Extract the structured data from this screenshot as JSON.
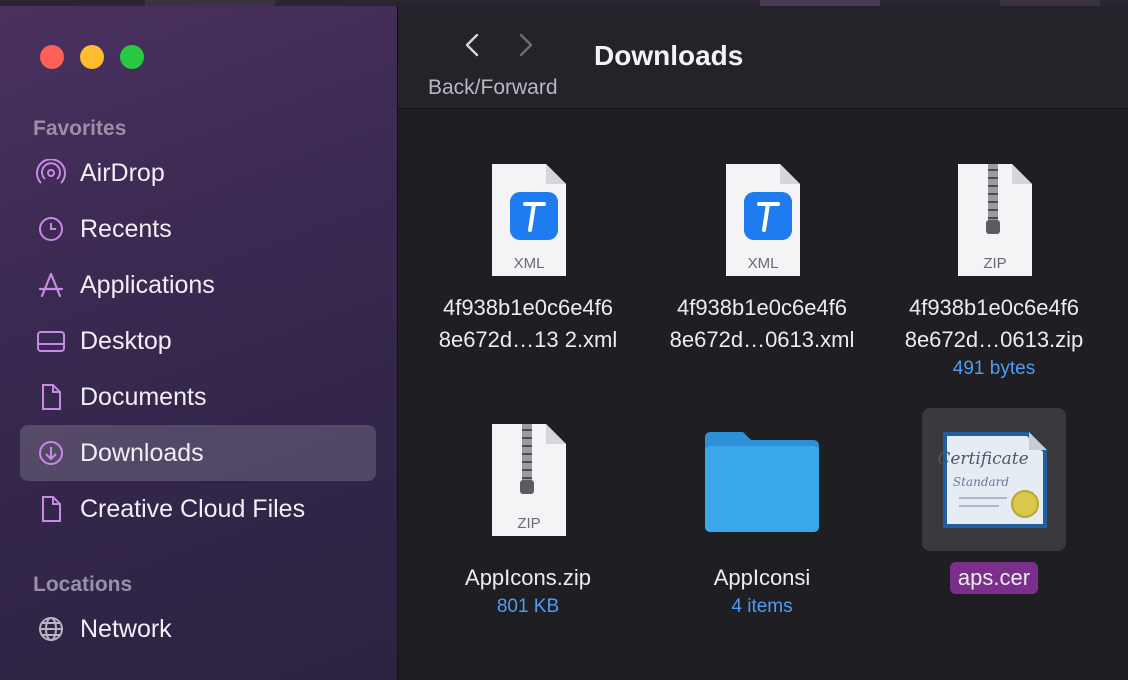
{
  "window": {
    "title": "Downloads"
  },
  "toolbar": {
    "back_icon": "chevron-left-icon",
    "forward_icon": "chevron-right-icon",
    "nav_label": "Back/Forward"
  },
  "sidebar": {
    "favorites_heading": "Favorites",
    "items": [
      {
        "label": "AirDrop",
        "icon": "airdrop-icon"
      },
      {
        "label": "Recents",
        "icon": "clock-icon"
      },
      {
        "label": "Applications",
        "icon": "applications-icon"
      },
      {
        "label": "Desktop",
        "icon": "desktop-icon"
      },
      {
        "label": "Documents",
        "icon": "document-icon"
      },
      {
        "label": "Downloads",
        "icon": "download-icon",
        "selected": true
      },
      {
        "label": "Creative Cloud Files",
        "icon": "file-icon"
      }
    ],
    "locations_heading": "Locations",
    "locations": [
      {
        "label": "Network",
        "icon": "globe-icon"
      }
    ]
  },
  "files": [
    {
      "line1": "4f938b1e0c6e4f6",
      "line2": "8e672d…13 2.xml",
      "meta": "",
      "icon_tag": "XML",
      "kind": "xml"
    },
    {
      "line1": "4f938b1e0c6e4f6",
      "line2": "8e672d…0613.xml",
      "meta": "",
      "icon_tag": "XML",
      "kind": "xml"
    },
    {
      "line1": "4f938b1e0c6e4f6",
      "line2": "8e672d…0613.zip",
      "meta": "491 bytes",
      "icon_tag": "ZIP",
      "kind": "zip"
    },
    {
      "line1": "AppIcons.zip",
      "line2": "",
      "meta": "801 KB",
      "icon_tag": "ZIP",
      "kind": "zip"
    },
    {
      "line1": "AppIconsi",
      "line2": "",
      "meta": "4 items",
      "icon_tag": "",
      "kind": "folder"
    },
    {
      "line1": "aps.cer",
      "line2": "",
      "meta": "",
      "icon_tag": "",
      "kind": "cert",
      "selected": true
    }
  ],
  "colors": {
    "accent": "#7a2f8a",
    "meta_text": "#4f9cf3",
    "folder": "#3aa7ea"
  }
}
